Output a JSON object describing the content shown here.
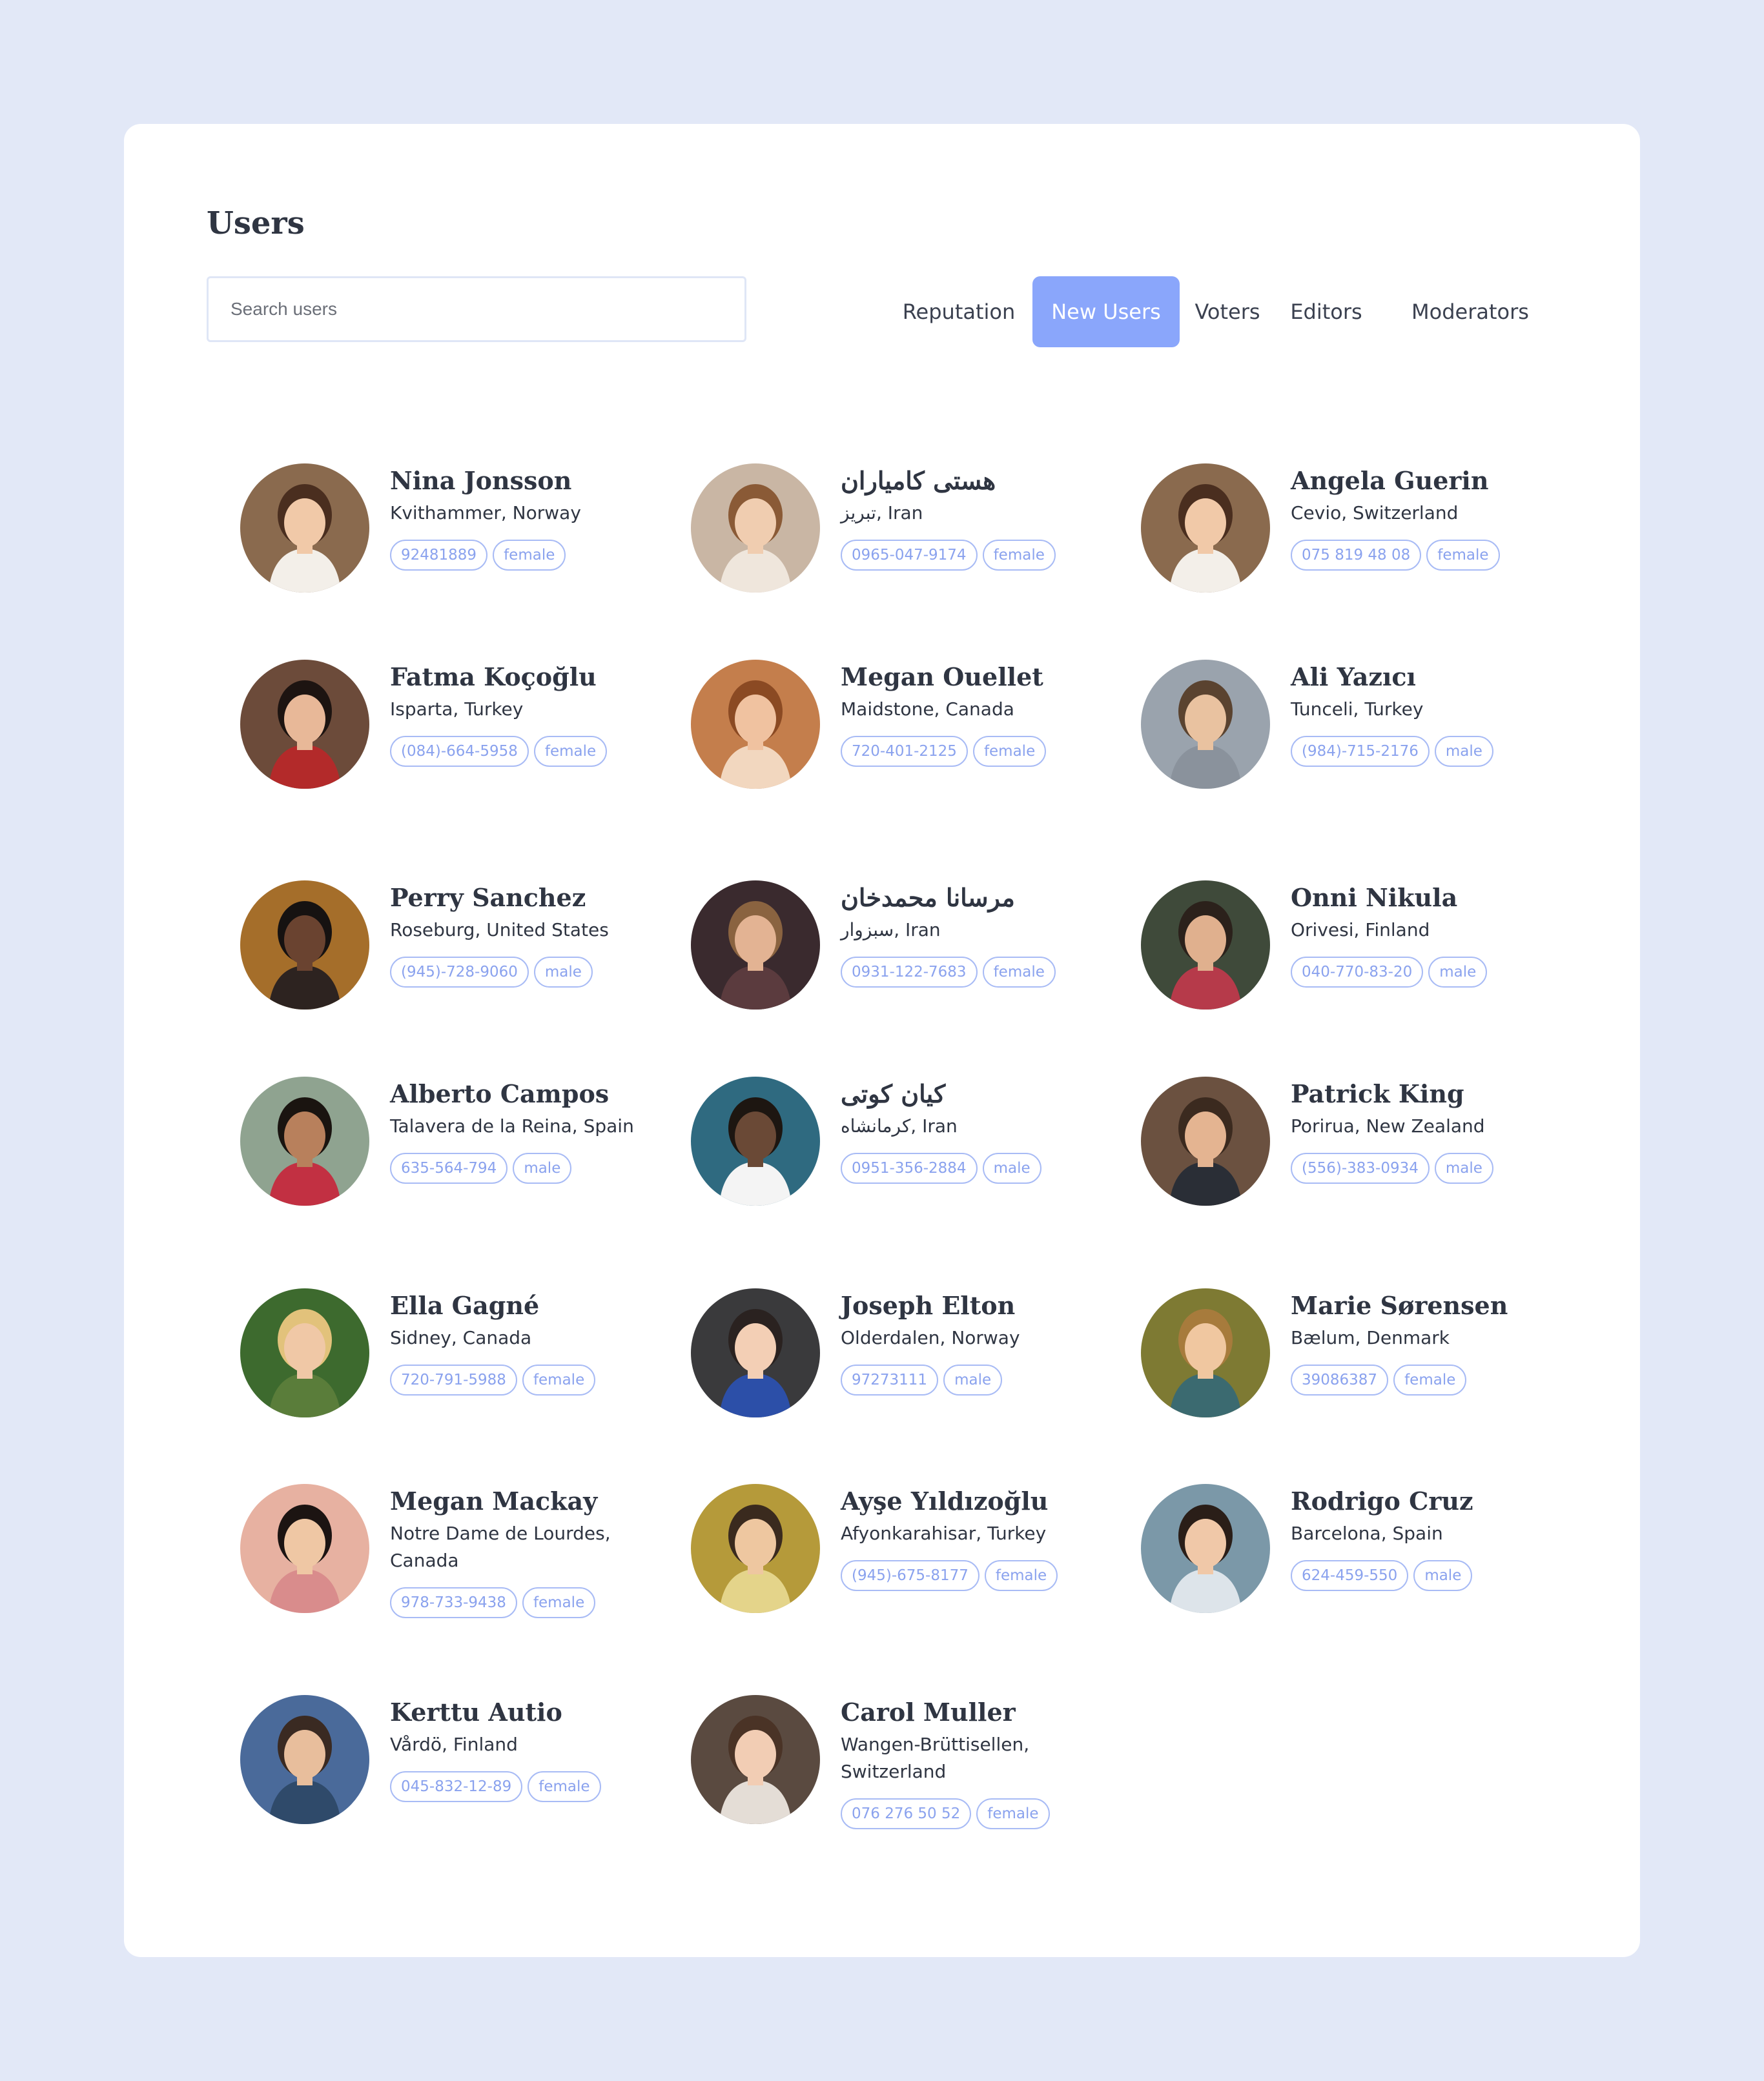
{
  "page": {
    "title": "Users"
  },
  "search": {
    "placeholder": "Search users",
    "value": ""
  },
  "tabs": [
    {
      "label": "Reputation",
      "active": false
    },
    {
      "label": "New Users",
      "active": true
    },
    {
      "label": "Voters",
      "active": false
    },
    {
      "label": "Editors",
      "active": false
    },
    {
      "label": "Moderators",
      "active": false
    }
  ],
  "users": [
    {
      "name": "Nina Jonsson",
      "location": "Kvithammer, Norway",
      "phone": "92481889",
      "gender": "female"
    },
    {
      "name": "هستی کامیاران",
      "location": "تبریز, Iran",
      "phone": "0965-047-9174",
      "gender": "female"
    },
    {
      "name": "Angela Guerin",
      "location": "Cevio, Switzerland",
      "phone": "075 819 48 08",
      "gender": "female"
    },
    {
      "name": "Fatma Koçoğlu",
      "location": "Isparta, Turkey",
      "phone": "(084)-664-5958",
      "gender": "female"
    },
    {
      "name": "Megan Ouellet",
      "location": "Maidstone, Canada",
      "phone": "720-401-2125",
      "gender": "female"
    },
    {
      "name": "Ali Yazıcı",
      "location": "Tunceli, Turkey",
      "phone": "(984)-715-2176",
      "gender": "male"
    },
    {
      "name": "Perry Sanchez",
      "location": "Roseburg, United States",
      "phone": "(945)-728-9060",
      "gender": "male"
    },
    {
      "name": "مرسانا محمدخان",
      "location": "سبزوار, Iran",
      "phone": "0931-122-7683",
      "gender": "female"
    },
    {
      "name": "Onni Nikula",
      "location": "Orivesi, Finland",
      "phone": "040-770-83-20",
      "gender": "male"
    },
    {
      "name": "Alberto Campos",
      "location": "Talavera de la Reina, Spain",
      "phone": "635-564-794",
      "gender": "male"
    },
    {
      "name": "کیان کوتی",
      "location": "کرمانشاه, Iran",
      "phone": "0951-356-2884",
      "gender": "male"
    },
    {
      "name": "Patrick King",
      "location": "Porirua, New Zealand",
      "phone": "(556)-383-0934",
      "gender": "male"
    },
    {
      "name": "Ella Gagné",
      "location": "Sidney, Canada",
      "phone": "720-791-5988",
      "gender": "female"
    },
    {
      "name": "Joseph Elton",
      "location": "Olderdalen, Norway",
      "phone": "97273111",
      "gender": "male"
    },
    {
      "name": "Marie Sørensen",
      "location": "Bælum, Denmark",
      "phone": "39086387",
      "gender": "female"
    },
    {
      "name": "Megan Mackay",
      "location": "Notre Dame de Lourdes, Canada",
      "phone": "978-733-9438",
      "gender": "female"
    },
    {
      "name": "Ayşe Yıldızoğlu",
      "location": "Afyonkarahisar, Turkey",
      "phone": "(945)-675-8177",
      "gender": "female"
    },
    {
      "name": "Rodrigo Cruz",
      "location": "Barcelona, Spain",
      "phone": "624-459-550",
      "gender": "male"
    },
    {
      "name": "Kerttu Autio",
      "location": "Vårdö, Finland",
      "phone": "045-832-12-89",
      "gender": "female"
    },
    {
      "name": "Carol Muller",
      "location": "Wangen-Brüttisellen, Switzerland",
      "phone": "076 276 50 52",
      "gender": "female"
    }
  ],
  "colors": {
    "page_bg": "#e2e8f7",
    "card_bg": "#ffffff",
    "accent": "#8aa6fb",
    "tag_border": "#a8bbf5",
    "tag_text": "#8aa2ee",
    "text_dark": "#2f3542"
  }
}
